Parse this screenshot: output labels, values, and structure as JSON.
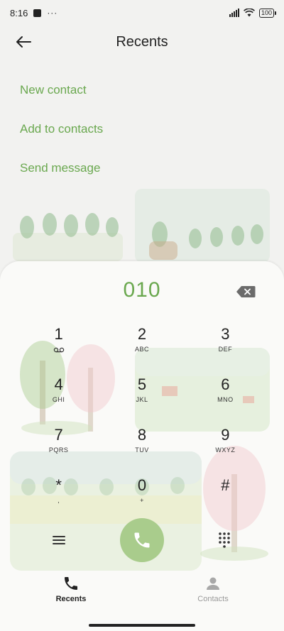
{
  "status_bar": {
    "time": "8:16",
    "extra": "···",
    "battery": "100"
  },
  "header": {
    "title": "Recents",
    "back_icon": "arrow-left-icon"
  },
  "actions": [
    {
      "label": "New contact"
    },
    {
      "label": "Add to contacts"
    },
    {
      "label": "Send message"
    }
  ],
  "dialer": {
    "number": "010",
    "accent_color": "#6aa84f",
    "call_color": "#a9cc8c",
    "keys": [
      {
        "digit": "1",
        "letters": "voicemail-icon"
      },
      {
        "digit": "2",
        "letters": "ABC"
      },
      {
        "digit": "3",
        "letters": "DEF"
      },
      {
        "digit": "4",
        "letters": "GHI"
      },
      {
        "digit": "5",
        "letters": "JKL"
      },
      {
        "digit": "6",
        "letters": "MNO"
      },
      {
        "digit": "7",
        "letters": "PQRS"
      },
      {
        "digit": "8",
        "letters": "TUV"
      },
      {
        "digit": "9",
        "letters": "WXYZ"
      },
      {
        "digit": "*",
        "letters": ","
      },
      {
        "digit": "0",
        "letters": "+"
      },
      {
        "digit": "#",
        "letters": ""
      }
    ]
  },
  "bottom_nav": [
    {
      "label": "Recents",
      "icon": "phone-icon",
      "active": true
    },
    {
      "label": "Contacts",
      "icon": "person-icon",
      "active": false
    }
  ]
}
